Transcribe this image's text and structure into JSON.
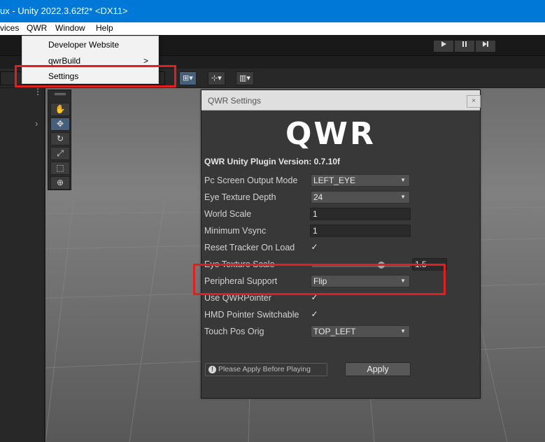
{
  "window": {
    "title": "ux - Unity 2022.3.62f2* <DX11>"
  },
  "menubar": {
    "items": [
      "vices",
      "QWR",
      "Window",
      "Help"
    ]
  },
  "playmode": {
    "play_icon": "play-icon",
    "pause_icon": "pause-icon",
    "step_icon": "step-icon"
  },
  "qwr_menu": {
    "items": [
      "Developer Website",
      "qwrBuild",
      "Settings"
    ],
    "submenu_arrow": ">"
  },
  "scenebar": {
    "tools": [
      "⊞▾",
      "⊹▾",
      "▥▾"
    ]
  },
  "leftpanel": {
    "menu_glyph": "⋮",
    "expand_glyph": "›"
  },
  "tool_palette": {
    "tools": [
      "view-tool-icon",
      "move-tool-icon",
      "rotate-tool-icon",
      "scale-tool-icon",
      "rect-tool-icon",
      "transform-tool-icon"
    ],
    "glyphs": [
      "✋",
      "✥",
      "↻",
      "⤢",
      "⬚",
      "⊕"
    ],
    "active": "move-tool-icon"
  },
  "settings": {
    "title": "QWR Settings",
    "close_glyph": "×",
    "logo": "QWR",
    "version": "QWR Unity Plugin Version: 0.7.10f",
    "rows": [
      {
        "label": "Pc Screen Output Mode",
        "value": "LEFT_EYE"
      },
      {
        "label": "Eye Texture Depth",
        "value": "24"
      },
      {
        "label": "World Scale",
        "value": "1"
      },
      {
        "label": "Minimum Vsync",
        "value": "1"
      },
      {
        "label": "Reset Tracker On Load",
        "value": true
      },
      {
        "label": "Eye Texture Scale",
        "value": "1.5"
      },
      {
        "label": "Peripheral Support",
        "value": "Flip"
      },
      {
        "label": "Use QWRPointer",
        "value": true
      },
      {
        "label": "HMD Pointer Switchable",
        "value": true
      },
      {
        "label": "Touch Pos Orig",
        "value": "TOP_LEFT"
      }
    ],
    "checkmark": "✓",
    "notice": "Please Apply Before Playing",
    "notice_icon": "!",
    "apply": "Apply"
  },
  "highlight_color": "#e02020"
}
